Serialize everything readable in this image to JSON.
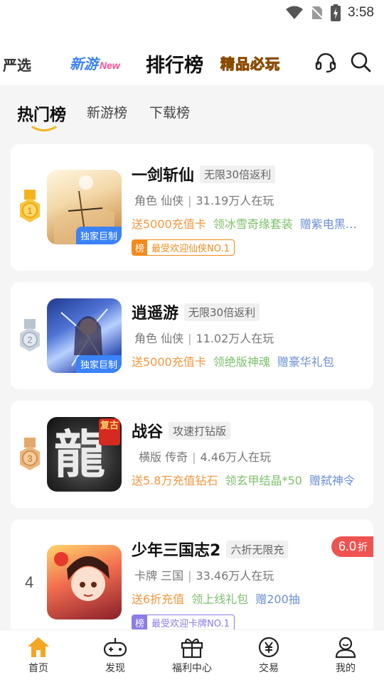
{
  "status": {
    "time": "3:58"
  },
  "topnav": {
    "yanxuan": "严选",
    "xinyou": "新游",
    "xinyou_new": "New",
    "paihang": "排行榜",
    "jingpin": "精品必玩"
  },
  "subtabs": [
    "热门榜",
    "新游榜",
    "下载榜"
  ],
  "games": [
    {
      "rank": "1",
      "title": "一剑斩仙",
      "tag": "无限30倍返利",
      "genre": "角色 仙侠",
      "players": "31.19万人在玩",
      "perks": [
        "送5000充值卡",
        "领冰雪奇缘套装",
        "赠紫电黑…"
      ],
      "badge": "独家巨制",
      "honor_key": "榜",
      "honor": "最受欢迎仙侠NO.1"
    },
    {
      "rank": "2",
      "title": "逍遥游",
      "tag": "无限30倍返利",
      "genre": "角色 仙侠",
      "players": "11.02万人在玩",
      "perks": [
        "送5000充值卡",
        "领绝版神魂",
        "赠豪华礼包"
      ],
      "badge": "独家巨制"
    },
    {
      "rank": "3",
      "title": "战谷",
      "tag": "攻速打钻版",
      "genre": "横版 传奇",
      "players": "4.46万人在玩",
      "perks": [
        "送5.8万充值钻石",
        "领玄甲结晶*50",
        "赠弑神令"
      ],
      "icon_text": "龍",
      "icon_badge": "复古"
    },
    {
      "rank": "4",
      "title": "少年三国志2",
      "tag": "六折无限充",
      "genre": "卡牌 三国",
      "players": "33.46万人在玩",
      "perks": [
        "送6折充值",
        "领上线礼包",
        "赠200抽"
      ],
      "honor_key": "榜",
      "honor": "最受欢迎卡牌NO.1",
      "discount": "6.0",
      "discount_unit": "折"
    }
  ],
  "bottom_nav": [
    "首页",
    "发现",
    "福利中心",
    "交易",
    "我的"
  ],
  "colors": {
    "accent": "#f5a623",
    "orange_perk": "#f5963d",
    "green_perk": "#7cc16b",
    "blue_perk": "#6a8ed4"
  }
}
